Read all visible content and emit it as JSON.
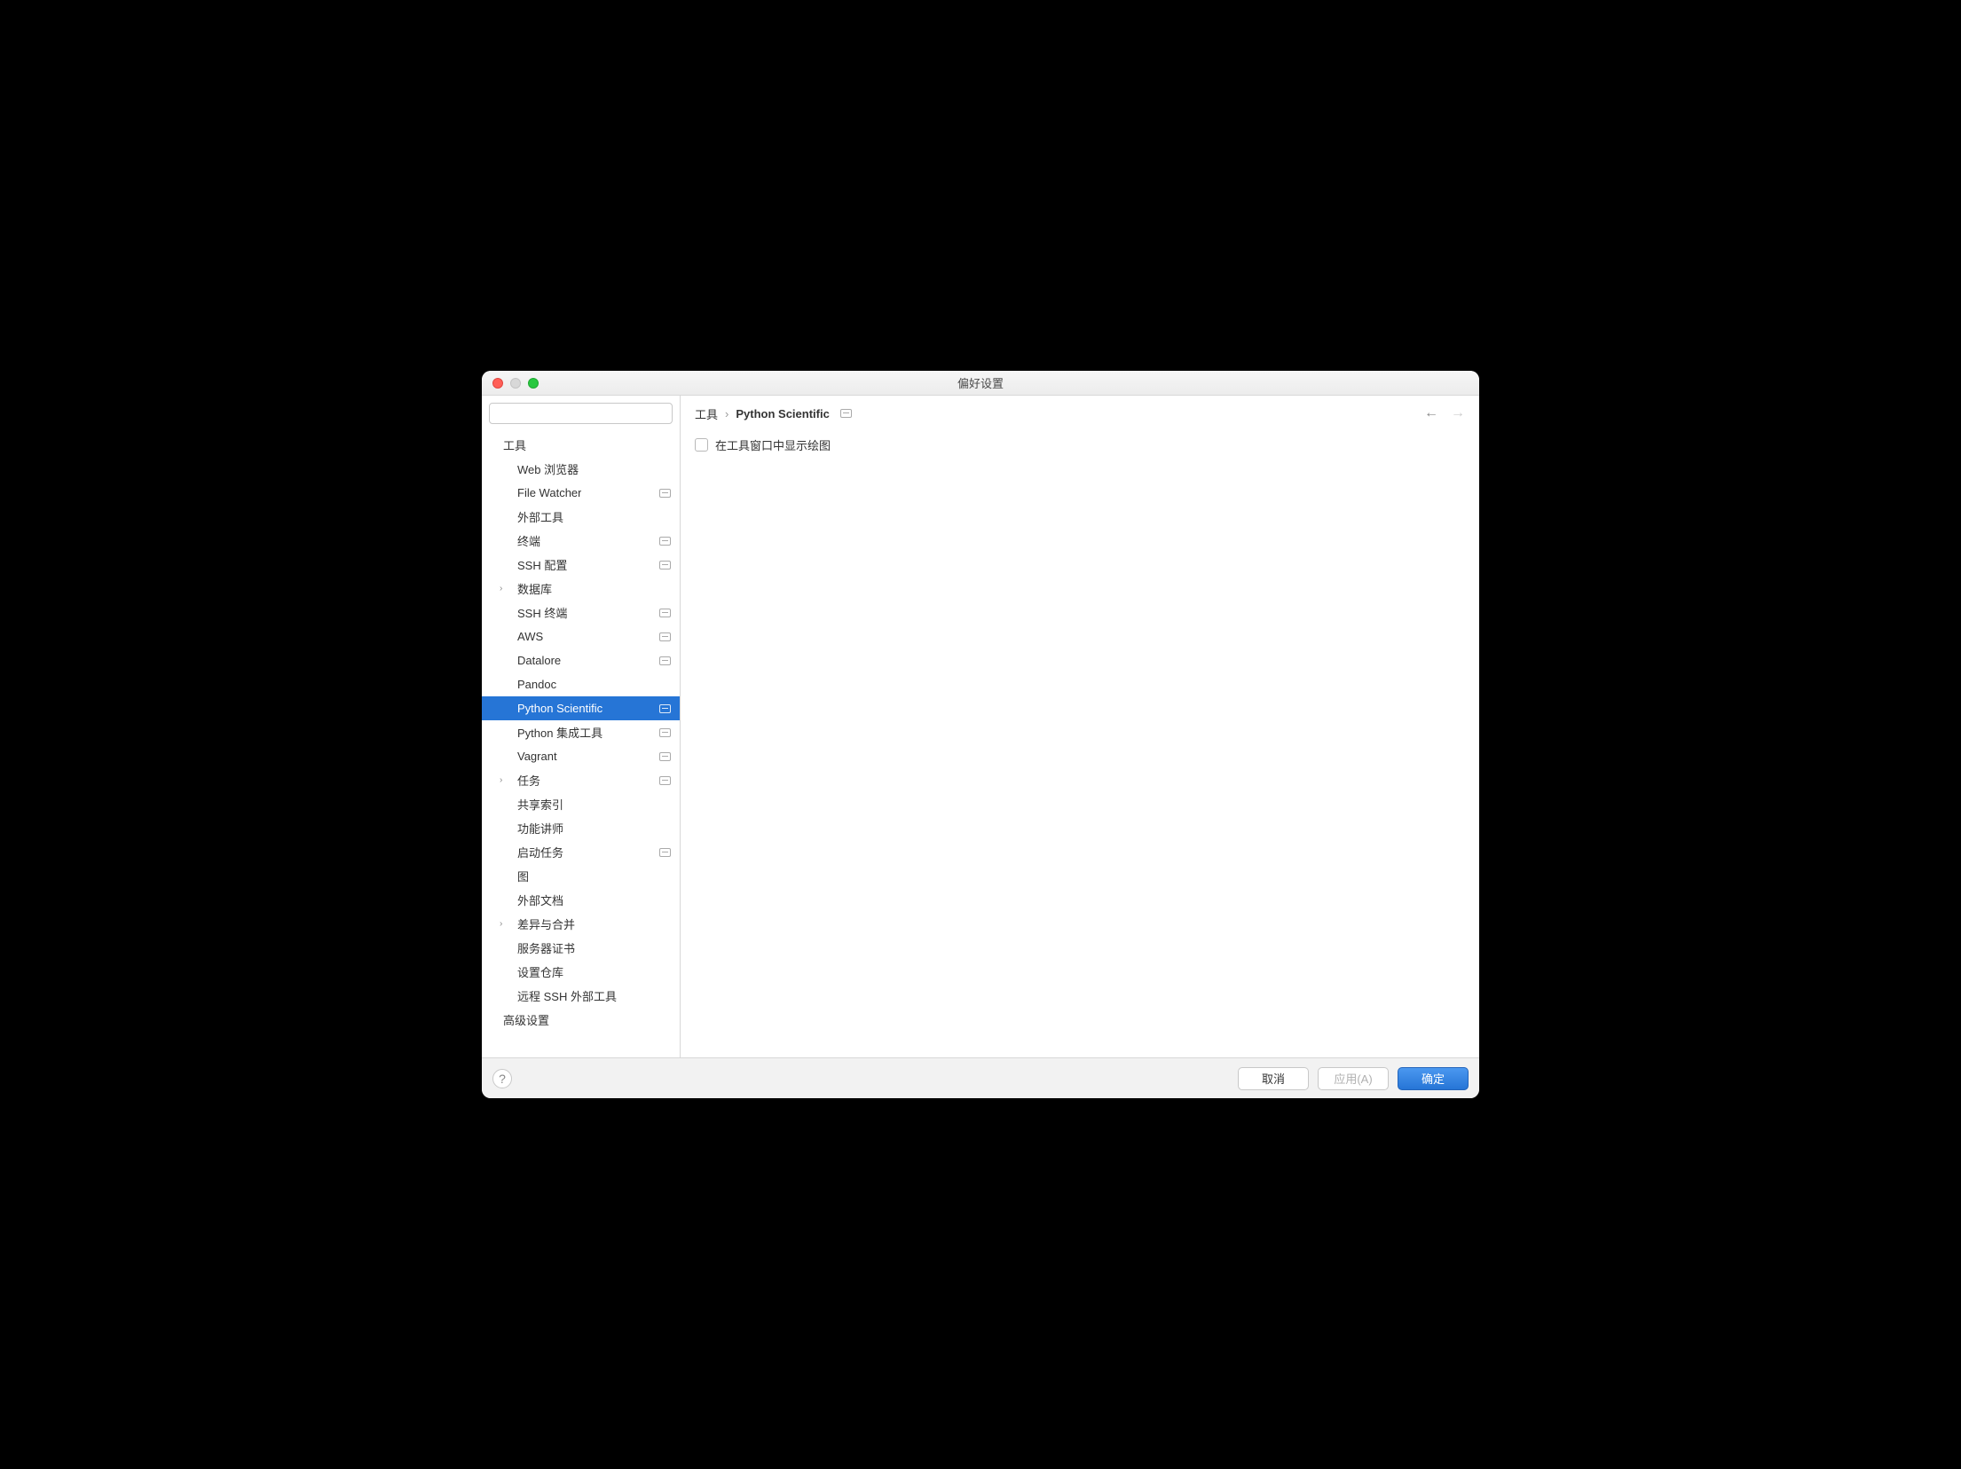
{
  "window": {
    "title": "偏好设置"
  },
  "search": {
    "placeholder": ""
  },
  "breadcrumb": {
    "root": "工具",
    "current": "Python Scientific"
  },
  "sidebar": {
    "items": [
      {
        "label": "工具",
        "level": 0,
        "badge": false,
        "expandable": false,
        "selected": false
      },
      {
        "label": "Web 浏览器",
        "level": 1,
        "badge": false,
        "expandable": false,
        "selected": false
      },
      {
        "label": "File Watcher",
        "level": 1,
        "badge": true,
        "expandable": false,
        "selected": false
      },
      {
        "label": "外部工具",
        "level": 1,
        "badge": false,
        "expandable": false,
        "selected": false
      },
      {
        "label": "终端",
        "level": 1,
        "badge": true,
        "expandable": false,
        "selected": false
      },
      {
        "label": "SSH 配置",
        "level": 1,
        "badge": true,
        "expandable": false,
        "selected": false
      },
      {
        "label": "数据库",
        "level": 1,
        "badge": false,
        "expandable": true,
        "selected": false
      },
      {
        "label": "SSH 终端",
        "level": 1,
        "badge": true,
        "expandable": false,
        "selected": false
      },
      {
        "label": "AWS",
        "level": 1,
        "badge": true,
        "expandable": false,
        "selected": false
      },
      {
        "label": "Datalore",
        "level": 1,
        "badge": true,
        "expandable": false,
        "selected": false
      },
      {
        "label": "Pandoc",
        "level": 1,
        "badge": false,
        "expandable": false,
        "selected": false
      },
      {
        "label": "Python Scientific",
        "level": 1,
        "badge": true,
        "expandable": false,
        "selected": true
      },
      {
        "label": "Python 集成工具",
        "level": 1,
        "badge": true,
        "expandable": false,
        "selected": false
      },
      {
        "label": "Vagrant",
        "level": 1,
        "badge": true,
        "expandable": false,
        "selected": false
      },
      {
        "label": "任务",
        "level": 1,
        "badge": true,
        "expandable": true,
        "selected": false
      },
      {
        "label": "共享索引",
        "level": 1,
        "badge": false,
        "expandable": false,
        "selected": false
      },
      {
        "label": "功能讲师",
        "level": 1,
        "badge": false,
        "expandable": false,
        "selected": false
      },
      {
        "label": "启动任务",
        "level": 1,
        "badge": true,
        "expandable": false,
        "selected": false
      },
      {
        "label": "图",
        "level": 1,
        "badge": false,
        "expandable": false,
        "selected": false
      },
      {
        "label": "外部文档",
        "level": 1,
        "badge": false,
        "expandable": false,
        "selected": false
      },
      {
        "label": "差异与合并",
        "level": 1,
        "badge": false,
        "expandable": true,
        "selected": false
      },
      {
        "label": "服务器证书",
        "level": 1,
        "badge": false,
        "expandable": false,
        "selected": false
      },
      {
        "label": "设置仓库",
        "level": 1,
        "badge": false,
        "expandable": false,
        "selected": false
      },
      {
        "label": "远程 SSH 外部工具",
        "level": 1,
        "badge": false,
        "expandable": false,
        "selected": false
      },
      {
        "label": "高级设置",
        "level": 0,
        "badge": false,
        "expandable": false,
        "selected": false
      }
    ]
  },
  "content": {
    "checkbox_label": "在工具窗口中显示绘图"
  },
  "footer": {
    "cancel": "取消",
    "apply": "应用(A)",
    "ok": "确定"
  }
}
